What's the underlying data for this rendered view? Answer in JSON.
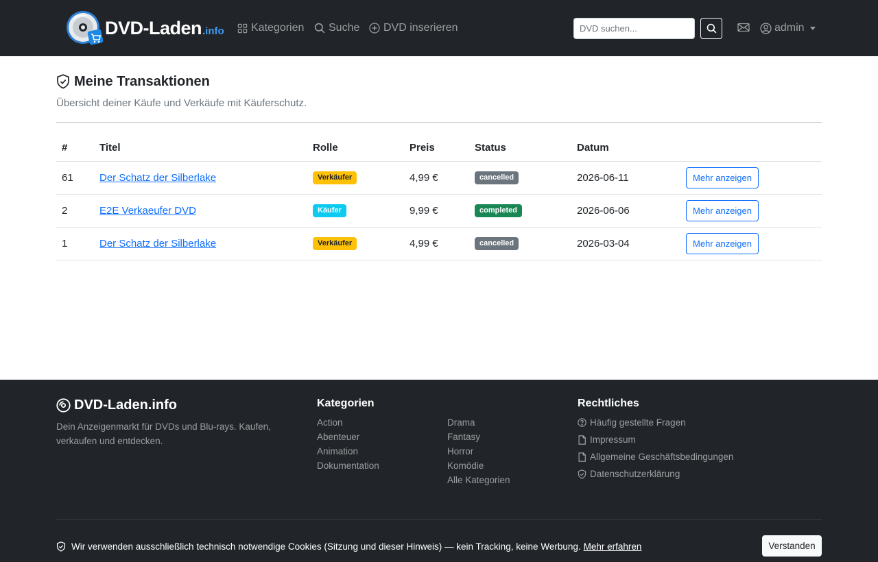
{
  "nav": {
    "brand_main": "DVD-Laden",
    "brand_suffix": ".info",
    "links": [
      {
        "label": "Kategorien",
        "icon": "grid-icon"
      },
      {
        "label": "Suche",
        "icon": "search-icon"
      },
      {
        "label": "DVD inserieren",
        "icon": "plus-circle-icon"
      }
    ],
    "search_placeholder": "DVD suchen...",
    "user_label": "admin"
  },
  "page": {
    "title": "Meine Transaktionen",
    "subtitle": "Übersicht deiner Käufe und Verkäufe mit Käuferschutz."
  },
  "table": {
    "headers": [
      "#",
      "Titel",
      "Rolle",
      "Preis",
      "Status",
      "Datum",
      ""
    ],
    "rows": [
      {
        "id": "61",
        "title": "Der Schatz der Silberlake",
        "role": "Verkäufer",
        "price": "4,99 €",
        "status": "cancelled",
        "date": "2026-06-11",
        "action": "Mehr anzeigen"
      },
      {
        "id": "2",
        "title": "E2E Verkaeufer DVD",
        "role": "Käufer",
        "price": "9,99 €",
        "status": "completed",
        "date": "2026-06-06",
        "action": "Mehr anzeigen"
      },
      {
        "id": "1",
        "title": "Der Schatz der Silberlake",
        "role": "Verkäufer",
        "price": "4,99 €",
        "status": "cancelled",
        "date": "2026-03-04",
        "action": "Mehr anzeigen"
      }
    ]
  },
  "footer": {
    "brand": "DVD-Laden.info",
    "description": "Dein Anzeigenmarkt für DVDs und Blu-rays. Kaufen, verkaufen und entdecken.",
    "categories_heading": "Kategorien",
    "categories_col1": [
      "Action",
      "Abenteuer",
      "Animation",
      "Dokumentation"
    ],
    "categories_col2": [
      "Drama",
      "Fantasy",
      "Horror",
      "Komödie",
      "Alle Kategorien"
    ],
    "legal_heading": "Rechtliches",
    "legal_links": [
      {
        "label": "Häufig gestellte Fragen",
        "icon": "question-circle-icon"
      },
      {
        "label": "Impressum",
        "icon": "document-icon"
      },
      {
        "label": "Allgemeine Geschäftsbedingungen",
        "icon": "document-icon"
      },
      {
        "label": "Datenschutzerklärung",
        "icon": "shield-check-icon"
      }
    ]
  },
  "cookie": {
    "text": "Wir verwenden ausschließlich technisch notwendige Cookies (Sitzung und dieser Hinweis) — kein Tracking, keine Werbung.",
    "link": "Mehr erfahren",
    "button": "Verstanden"
  },
  "colors": {
    "navbar_bg": "#212529",
    "link_blue": "#0d6efd",
    "badge_warning": "#ffc107",
    "badge_info": "#0dcaf0",
    "badge_secondary": "#6c757d",
    "badge_success": "#198754"
  }
}
